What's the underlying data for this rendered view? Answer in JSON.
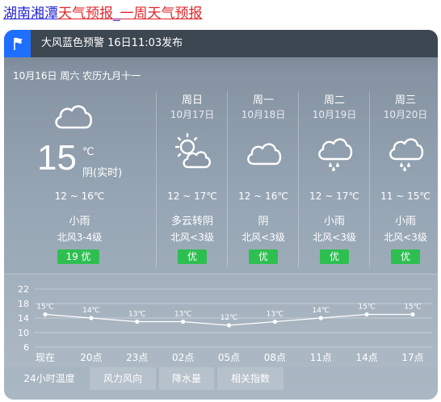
{
  "page": {
    "city": "湖南湘潭",
    "title_rest": "天气预报",
    "separator": "_",
    "week_title": "一周天气预报"
  },
  "alert": {
    "text": "大风蓝色预警 16日11:03发布",
    "icon": "flag-icon"
  },
  "today": {
    "date_line": "10月16日 周六 农历九月十一",
    "icon": "cloudy-icon",
    "temp": "15",
    "unit": "℃",
    "condition": "阴(实时)",
    "range": "12 ~ 16℃",
    "weather": "小雨",
    "wind": "北风3-4级",
    "aqi": "19  优"
  },
  "forecast": [
    {
      "weekday": "周日",
      "date": "10月17日",
      "icon": "partly-cloudy-sun-icon",
      "range": "12 ~ 17℃",
      "condition": "多云转阴",
      "wind": "北风<3级",
      "aqi": "优"
    },
    {
      "weekday": "周一",
      "date": "10月18日",
      "icon": "cloudy-icon",
      "range": "12 ~ 16℃",
      "condition": "阴",
      "wind": "北风<3级",
      "aqi": "优"
    },
    {
      "weekday": "周二",
      "date": "10月19日",
      "icon": "light-rain-icon",
      "range": "12 ~ 17℃",
      "condition": "小雨",
      "wind": "北风<3级",
      "aqi": "优"
    },
    {
      "weekday": "周三",
      "date": "10月20日",
      "icon": "light-rain-icon",
      "range": "11 ~ 15℃",
      "condition": "小雨",
      "wind": "北风<3级",
      "aqi": "优"
    }
  ],
  "tabs": [
    "24小时温度",
    "风力风向",
    "降水量",
    "相关指数"
  ],
  "chart_data": {
    "type": "line",
    "categories": [
      "现在",
      "20点",
      "23点",
      "02点",
      "05点",
      "08点",
      "11点",
      "14点",
      "17点"
    ],
    "values": [
      15,
      14,
      13,
      13,
      12,
      13,
      14,
      15,
      15
    ],
    "point_labels": [
      "15℃",
      "14℃",
      "13℃",
      "13℃",
      "12℃",
      "13℃",
      "14℃",
      "15℃",
      "15℃"
    ],
    "yticks": [
      "22",
      "18",
      "14",
      "10",
      "6"
    ],
    "ylim": [
      6,
      22
    ],
    "grid": true
  }
}
